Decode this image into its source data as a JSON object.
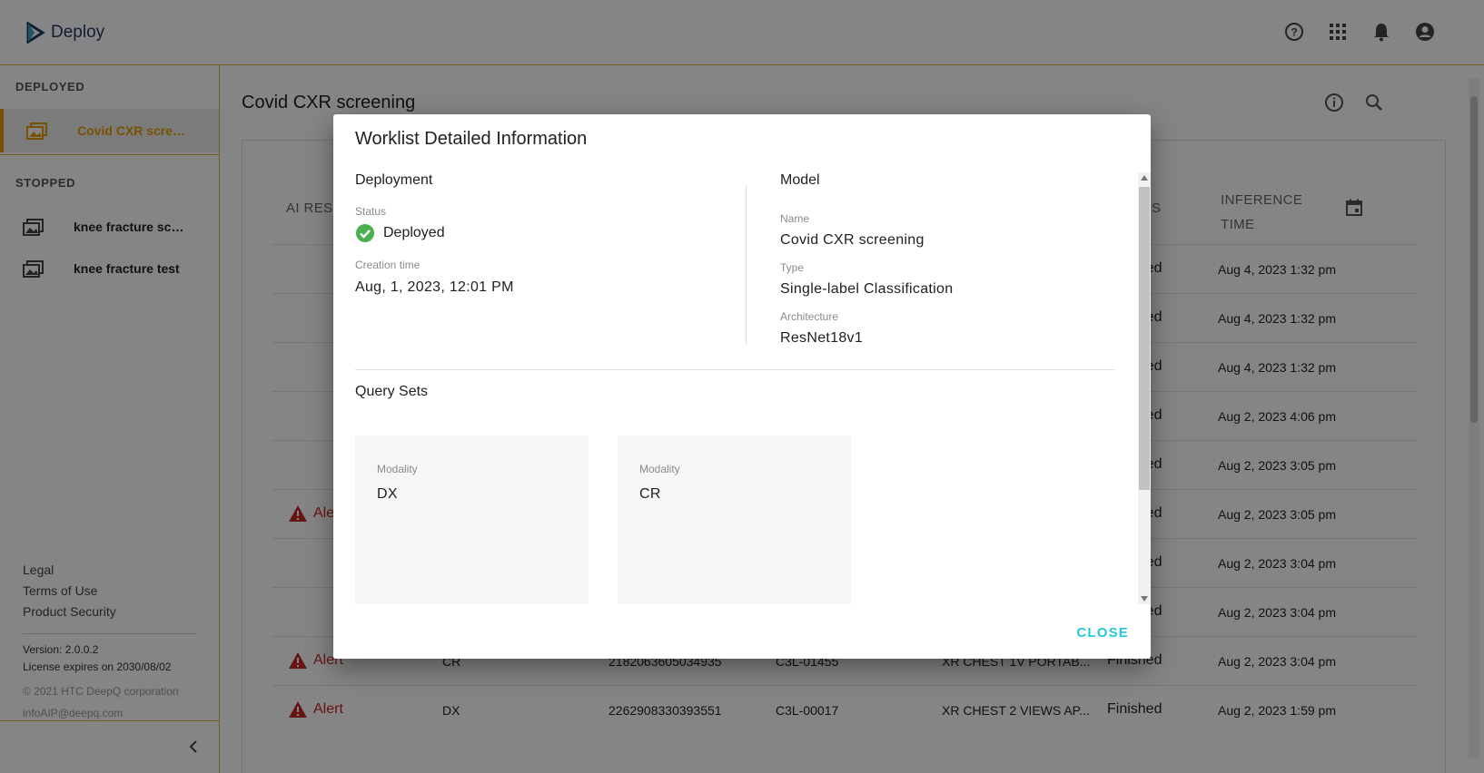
{
  "header": {
    "app_name": "Deploy",
    "icons": [
      "help-icon",
      "apps-grid-icon",
      "notifications-bell-icon",
      "account-circle-icon"
    ]
  },
  "sidebar": {
    "deployed_label": "DEPLOYED",
    "stopped_label": "STOPPED",
    "deployed_items": [
      {
        "label": "Covid CXR scree..."
      }
    ],
    "stopped_items": [
      {
        "label": "knee fracture scr..."
      },
      {
        "label": "knee fracture test"
      }
    ],
    "footer": {
      "legal": "Legal",
      "terms": "Terms of Use",
      "security": "Product Security",
      "version": "Version: 2.0.0.2",
      "license": "License expires on 2030/08/02",
      "copyright": "© 2021 HTC DeepQ corporation",
      "email": "infoAIP@deepq.com"
    }
  },
  "main": {
    "title": "Covid CXR screening",
    "columns": {
      "ai_result": "AI RES",
      "status": "STATUS",
      "inference_time": "INFERENCE TIME"
    },
    "rows": [
      {
        "ai": "",
        "modality": "",
        "accession": "",
        "patient": "",
        "exam": "",
        "status": "Finished",
        "time": "Aug 4, 2023 1:32 pm"
      },
      {
        "ai": "",
        "modality": "",
        "accession": "",
        "patient": "",
        "exam": "",
        "status": "Finished",
        "time": "Aug 4, 2023 1:32 pm"
      },
      {
        "ai": "",
        "modality": "",
        "accession": "",
        "patient": "",
        "exam": "",
        "status": "Finished",
        "time": "Aug 4, 2023 1:32 pm"
      },
      {
        "ai": "",
        "modality": "",
        "accession": "",
        "patient": "",
        "exam": "",
        "status": "Finished",
        "time": "Aug 2, 2023 4:06 pm"
      },
      {
        "ai": "",
        "modality": "",
        "accession": "",
        "patient": "",
        "exam": "",
        "status": "Finished",
        "time": "Aug 2, 2023 3:05 pm"
      },
      {
        "ai": "Alert",
        "modality": "",
        "accession": "",
        "patient": "",
        "exam": "",
        "status": "Finished",
        "time": "Aug 2, 2023 3:05 pm"
      },
      {
        "ai": "",
        "modality": "",
        "accession": "",
        "patient": "",
        "exam": "",
        "status": "Finished",
        "time": "Aug 2, 2023 3:04 pm"
      },
      {
        "ai": "",
        "modality": "",
        "accession": "",
        "patient": "",
        "exam": "",
        "status": "Finished",
        "time": "Aug 2, 2023 3:04 pm"
      },
      {
        "ai": "Alert",
        "modality": "CR",
        "accession": "2182063605034935",
        "patient": "C3L-01455",
        "exam": "XR CHEST 1V PORTAB...",
        "status": "Finished",
        "time": "Aug 2, 2023 3:04 pm"
      },
      {
        "ai": "Alert",
        "modality": "DX",
        "accession": "2262908330393551",
        "patient": "C3L-00017",
        "exam": "XR CHEST 2 VIEWS AP...",
        "status": "Finished",
        "time": "Aug 2, 2023 1:59 pm"
      }
    ]
  },
  "modal": {
    "title": "Worklist Detailed Information",
    "deployment": {
      "heading": "Deployment",
      "status_label": "Status",
      "status_value": "Deployed",
      "creation_label": "Creation time",
      "creation_value": "Aug, 1, 2023, 12:01 PM"
    },
    "model": {
      "heading": "Model",
      "name_label": "Name",
      "name_value": "Covid CXR screening",
      "type_label": "Type",
      "type_value": "Single-label Classification",
      "arch_label": "Architecture",
      "arch_value": "ResNet18v1"
    },
    "query_sets": {
      "heading": "Query Sets",
      "items": [
        {
          "label": "Modality",
          "value": "DX"
        },
        {
          "label": "Modality",
          "value": "CR"
        }
      ]
    },
    "close_label": "CLOSE"
  },
  "colors": {
    "accent": "#e3a008",
    "alert": "#c62828",
    "success": "#4caf50",
    "close": "#26c6da"
  }
}
